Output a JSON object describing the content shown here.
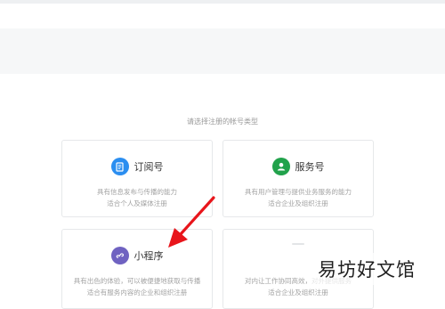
{
  "page": {
    "prompt": "请选择注册的帐号类型"
  },
  "account_types": [
    {
      "title": "订阅号",
      "desc_line1": "具有信息发布与传播的能力",
      "desc_line2": "适合个人及媒体注册",
      "icon": "subscription-doc-icon",
      "color": "#2b8ef0"
    },
    {
      "title": "服务号",
      "desc_line1": "具有用户管理与提供业务服务的能力",
      "desc_line2": "适合企业及组织注册",
      "icon": "service-user-icon",
      "color": "#21a24b"
    },
    {
      "title": "小程序",
      "desc_line1": "具有出色的体验，可以被便捷地获取与传播",
      "desc_line2": "适合有服务内容的企业和组织注册",
      "icon": "miniprogram-link-icon",
      "color": "#6f62c1"
    },
    {
      "title": "",
      "desc_line1": "对内让工作协同高效，对外提供服务",
      "desc_line2": "适合企业及组织注册",
      "icon": "enterprise-icon",
      "color": "#e3e5e7"
    }
  ],
  "annotation": {
    "arrow_color": "#e8151b"
  },
  "watermark": {
    "text": "易坊好文馆"
  }
}
